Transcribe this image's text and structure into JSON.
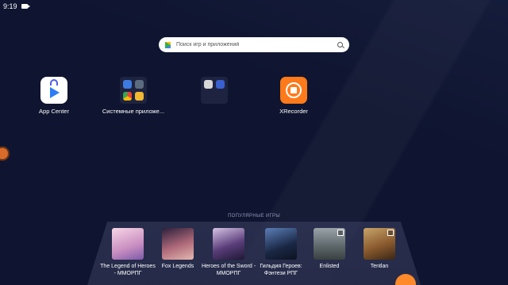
{
  "status": {
    "time": "9:19"
  },
  "search": {
    "placeholder": "Поиск игр и приложений"
  },
  "apps": [
    {
      "label": "App Center"
    },
    {
      "label": "Системные приложе..."
    },
    {
      "label": ""
    },
    {
      "label": "XRecorder"
    }
  ],
  "popular": {
    "title": "ПОПУЛЯРНЫЕ ИГРЫ",
    "games": [
      {
        "label": "The Legend of Heroes - ММОРПГ"
      },
      {
        "label": "Fox Legends"
      },
      {
        "label": "Heroes of the Sword - ММОРПГ"
      },
      {
        "label": "Гильдия Героев: Фэнтези РПГ"
      },
      {
        "label": "Enlisted"
      },
      {
        "label": "Tentlan"
      }
    ]
  },
  "colors": {
    "accent": "#ff7a1a",
    "background": "#0f1530"
  }
}
